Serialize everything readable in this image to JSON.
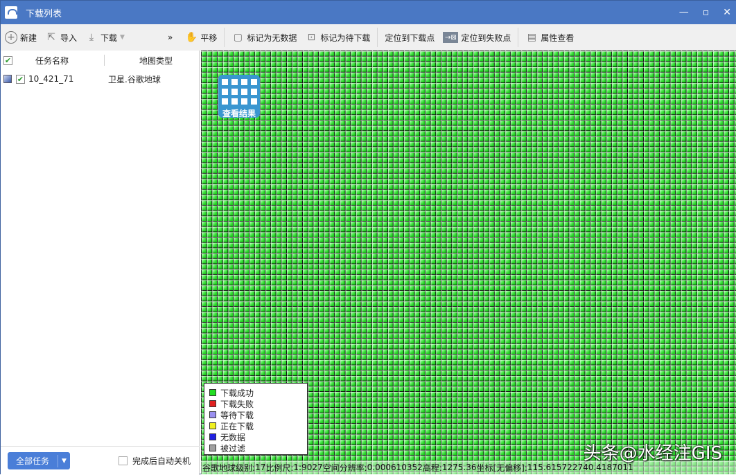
{
  "window": {
    "title": "下载列表"
  },
  "toolbar": {
    "new": "新建",
    "import": "导入",
    "download": "下载",
    "more": "»",
    "pan": "平移",
    "mark_nodata": "标记为无数据",
    "mark_pending": "标记为待下载",
    "locate_download": "定位到下载点",
    "locate_failed": "定位到失败点",
    "properties": "属性查看"
  },
  "tasks": {
    "headers": [
      "任务名称",
      "地图类型"
    ],
    "rows": [
      {
        "name": "10_421_71",
        "type": "卫星.谷歌地球",
        "checked": true
      }
    ]
  },
  "footer": {
    "all_tasks": "全部任务",
    "shutdown": "完成后自动关机"
  },
  "map": {
    "result_button": "查看结果",
    "legend": [
      {
        "label": "下载成功",
        "color": "#22dd22"
      },
      {
        "label": "下载失败",
        "color": "#e02020"
      },
      {
        "label": "等待下载",
        "color": "#9a90f0"
      },
      {
        "label": "正在下载",
        "color": "#f0f020"
      },
      {
        "label": "无数据",
        "color": "#2020e0"
      },
      {
        "label": "被过滤",
        "color": "#a0a0a0"
      }
    ],
    "status": {
      "source": "谷歌地球",
      "level_label": "级别:",
      "level": "17",
      "scale_label": "比例尺:",
      "scale": "1:9027",
      "res_label": "空间分辨率:",
      "res": "0.000610352",
      "elev_label": "高程:",
      "elev": "1275.36",
      "coord_label": "坐标[无偏移]:",
      "lon": "115.6157227",
      "lat": "40.4187011"
    },
    "watermark": "头条@水经注GIS"
  }
}
